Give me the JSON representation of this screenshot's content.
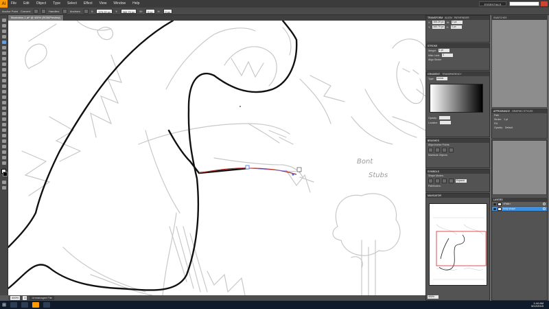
{
  "app": {
    "logo": "Ai",
    "menus": [
      "File",
      "Edit",
      "Object",
      "Type",
      "Select",
      "Effect",
      "View",
      "Window",
      "Help"
    ],
    "workspace": "ESSENTIALS",
    "accent": "#ff9a00"
  },
  "control_bar": {
    "tool_label": "Anchor Point",
    "convert_label": "Convert:",
    "handles_label": "Handles:",
    "anchors_label": "Anchors:",
    "x_label": "X:",
    "x_value": "375.29 px",
    "y_label": "Y:",
    "y_value": "360.79 px",
    "w_label": "W:",
    "w_value": "0 px",
    "h_label": "H:",
    "h_value": "0 px"
  },
  "tabs": [
    {
      "label": "Illustration-1.ai* @ 400% (RGB/Preview)",
      "active": true
    }
  ],
  "canvas": {
    "sketch_note_line1": "Bont",
    "sketch_note_line2": "Stubs"
  },
  "status_bar": {
    "zoom": "400%",
    "page": "1",
    "info": "Unmanaged File"
  },
  "panels": {
    "transform": {
      "tabs": [
        "Transform",
        "Align",
        "Pathfinder"
      ],
      "x": "305.29 px",
      "y": "360.79 px",
      "w": "0 px",
      "h": "0 px"
    },
    "stroke": {
      "tabs": [
        "Stroke"
      ],
      "weight_label": "Weight:",
      "weight_value": "1 pt",
      "miter_label": "Miter Limit:",
      "miter_value": "4",
      "align_label": "Align Stroke:"
    },
    "gradient": {
      "tabs": [
        "Gradient",
        "Transparency"
      ],
      "type_label": "Type:",
      "type_value": "Linear",
      "opacity_label": "Opacity:",
      "location_label": "Location:"
    },
    "appearance": {
      "tabs": [
        "Appearance",
        "Graphic Styles"
      ],
      "rows": [
        {
          "label": "Path"
        },
        {
          "label": "Stroke:",
          "value": "1 pt"
        },
        {
          "label": "Fill:"
        },
        {
          "label": "Opacity:",
          "value": "Default"
        }
      ]
    },
    "brushes": {
      "tabs": [
        "Brushes"
      ],
      "align_label": "Align Anchor Points:",
      "distribute_label": "Distribute Objects:"
    },
    "symbols": {
      "tabs": [
        "Symbols",
        "Swatches"
      ],
      "shape_label": "Shape Modes:",
      "pathfinder_label": "Pathfinders:",
      "expand_label": "Expand"
    },
    "navigator": {
      "tabs": [
        "Navigator"
      ],
      "zoom": "400%"
    },
    "layers": {
      "tabs": [
        "Layers"
      ],
      "rows": [
        {
          "name": "<Path>",
          "selected": false
        },
        {
          "name": "body shape",
          "selected": true
        }
      ]
    }
  },
  "taskbar": {
    "time": "1:44 AM",
    "date": "6/12/2015"
  }
}
